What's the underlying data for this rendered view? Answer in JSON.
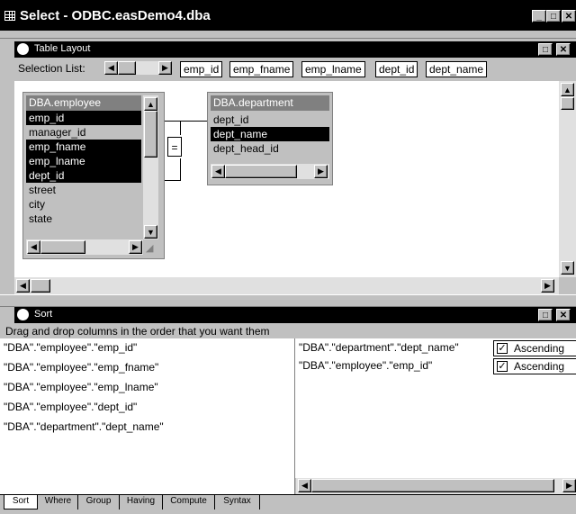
{
  "window": {
    "title": "Select - ODBC.easDemo4.dba"
  },
  "table_layout": {
    "title": "Table Layout",
    "selection_label": "Selection List:",
    "selection_items": [
      "emp_id",
      "emp_fname",
      "emp_lname",
      "dept_id",
      "dept_name"
    ],
    "employee": {
      "name": "DBA.employee",
      "columns": [
        "emp_id",
        "manager_id",
        "emp_fname",
        "emp_lname",
        "dept_id",
        "street",
        "city",
        "state"
      ],
      "selected": [
        "emp_id",
        "emp_fname",
        "emp_lname",
        "dept_id"
      ]
    },
    "department": {
      "name": "DBA.department",
      "columns": [
        "dept_id",
        "dept_name",
        "dept_head_id"
      ],
      "selected": [
        "dept_name"
      ]
    },
    "join_label": "="
  },
  "sort": {
    "title": "Sort",
    "instruction": "Drag and drop columns in the order that you want them",
    "available": [
      "\"DBA\".\"employee\".\"emp_id\"",
      "\"DBA\".\"employee\".\"emp_fname\"",
      "\"DBA\".\"employee\".\"emp_lname\"",
      "\"DBA\".\"employee\".\"dept_id\"",
      "\"DBA\".\"department\".\"dept_name\""
    ],
    "sorted": [
      {
        "column": "\"DBA\".\"department\".\"dept_name\"",
        "order": "Ascending",
        "checked": true
      },
      {
        "column": "\"DBA\".\"employee\".\"emp_id\"",
        "order": "Ascending",
        "checked": true
      }
    ],
    "tabs": [
      "Sort",
      "Where",
      "Group",
      "Having",
      "Compute",
      "Syntax"
    ]
  },
  "icons": {
    "app": "grid-icon",
    "pane": "painter-icon"
  }
}
